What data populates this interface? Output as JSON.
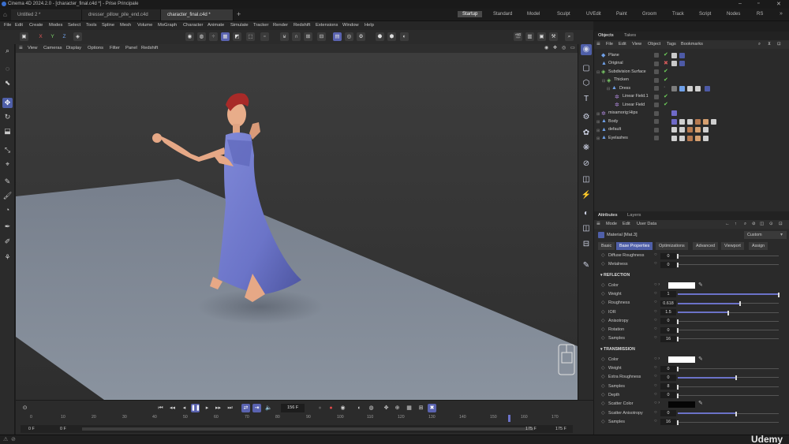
{
  "window": {
    "title": "Cinema 4D 2024.2.0 - [character_final.c4d *] - Prise Principale"
  },
  "doc_tabs": [
    {
      "label": "Untitled 2 *"
    },
    {
      "label": "dresser_pillow_pile_end.c4d"
    },
    {
      "label": "character_final.c4d *"
    }
  ],
  "layouts": [
    "Startup",
    "Standard",
    "Model",
    "Sculpt",
    "UVEdit",
    "Paint",
    "Groom",
    "Track",
    "Script",
    "Nodes",
    "RS"
  ],
  "active_layout": "Startup",
  "main_menu": [
    "File",
    "Edit",
    "Create",
    "Modes",
    "Select",
    "Tools",
    "Spline",
    "Mesh",
    "Volume",
    "MoGraph",
    "Character",
    "Animate",
    "Simulate",
    "Tracker",
    "Render",
    "Redshift",
    "Extensions",
    "Window",
    "Help"
  ],
  "toolbar_axes": {
    "x": "X",
    "y": "Y",
    "z": "Z"
  },
  "viewport_menu": [
    "View",
    "Cameras",
    "Display",
    "Options",
    "Filter",
    "Panel",
    "Redshift"
  ],
  "objects_panel": {
    "tabs": [
      "Objects",
      "Takes"
    ],
    "menu": [
      "File",
      "Edit",
      "View",
      "Object",
      "Tags",
      "Bookmarks"
    ],
    "rows": [
      {
        "name": "Plane"
      },
      {
        "name": "Original"
      },
      {
        "name": "Subdivision Surface"
      },
      {
        "name": "Thicken"
      },
      {
        "name": "Dress"
      },
      {
        "name": "Linear Field.1"
      },
      {
        "name": "Linear Field"
      },
      {
        "name": "mixamorig:Hips"
      },
      {
        "name": "Body"
      },
      {
        "name": "default"
      },
      {
        "name": "Eyelashes"
      }
    ]
  },
  "attributes_panel": {
    "tabs": [
      "Attributes",
      "Layers"
    ],
    "menu": [
      "Mode",
      "Edit",
      "User Data"
    ],
    "material": "Material [Mat.3]",
    "preset": "Custom",
    "subtabs": [
      "Basic",
      "Base Properties",
      "Optimizations",
      "Advanced",
      "Viewport",
      "Assign"
    ],
    "active_subtab": "Base Properties",
    "rows_top": [
      {
        "label": "Diffuse Roughness",
        "value": "0",
        "fill": 0.0
      },
      {
        "label": "Metalness",
        "value": "0",
        "fill": 0.0
      }
    ],
    "reflection": {
      "header": "REFLECTION",
      "color_label": "Color",
      "rows": [
        {
          "label": "Weight",
          "value": "1",
          "fill": 1.0
        },
        {
          "label": "Roughness",
          "value": "0.618",
          "fill": 0.618
        },
        {
          "label": "IOR",
          "value": "1.5",
          "fill": 0.5
        },
        {
          "label": "Anisotropy",
          "value": "0",
          "fill": 0.0
        },
        {
          "label": "Rotation",
          "value": "0",
          "fill": 0.0
        },
        {
          "label": "Samples",
          "value": "16",
          "fill": 0.0
        }
      ]
    },
    "transmission": {
      "header": "TRANSMISSION",
      "color_label": "Color",
      "rows": [
        {
          "label": "Weight",
          "value": "0",
          "fill": 0.0
        },
        {
          "label": "Extra Roughness",
          "value": "0",
          "fill": 0.58
        },
        {
          "label": "Samples",
          "value": "8",
          "fill": 0.0
        },
        {
          "label": "Depth",
          "value": "0",
          "fill": 0.0
        }
      ],
      "scatter_color_label": "Scatter Color",
      "rows2": [
        {
          "label": "Scatter Anisotropy",
          "value": "0",
          "fill": 0.58
        },
        {
          "label": "Samples",
          "value": "16",
          "fill": 0.0
        }
      ]
    }
  },
  "timeline": {
    "current_frame": "156 F",
    "start": "0 F",
    "start2": "0 F",
    "end": "175 F",
    "end2": "175 F",
    "ticks": [
      "0",
      "10",
      "20",
      "30",
      "40",
      "50",
      "60",
      "70",
      "80",
      "90",
      "100",
      "110",
      "120",
      "130",
      "140",
      "150",
      "160",
      "170"
    ],
    "playhead_frame": 156,
    "max_frame": 175
  },
  "watermark": "Udemy",
  "colors": {
    "accent": "#5a63b0",
    "dress": "#6b74c8",
    "hair": "#a82a28"
  }
}
